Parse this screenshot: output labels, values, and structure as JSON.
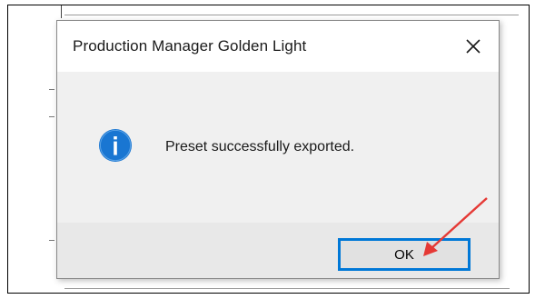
{
  "dialog": {
    "title": "Production Manager Golden Light",
    "message": "Preset successfully exported.",
    "ok_label": "OK",
    "close_glyph": "✕"
  },
  "icons": {
    "info": "info-icon",
    "close": "close-icon",
    "annotation": "red-arrow-annotation"
  },
  "colors": {
    "info_icon": "#1976d2",
    "button_focus_border": "#0078d7",
    "annotation_arrow": "#e53935",
    "dialog_body": "#f0f0f0"
  }
}
